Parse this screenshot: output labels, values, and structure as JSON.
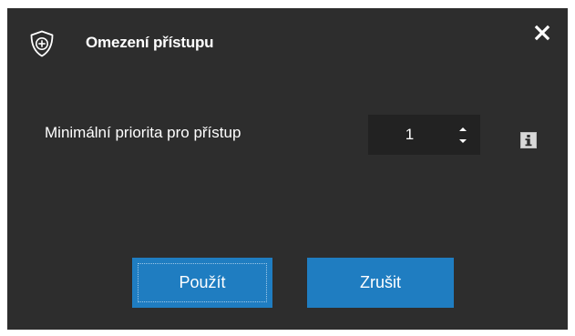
{
  "dialog": {
    "title": "Omezení přístupu",
    "icons": {
      "title_icon": "shield-plus-icon",
      "close": "close-icon",
      "info": "info-icon",
      "stepper_up": "chevron-up-icon",
      "stepper_down": "chevron-down-icon"
    },
    "field": {
      "label": "Minimální priorita pro přístup",
      "value": "1"
    },
    "buttons": {
      "apply_label": "Použít",
      "cancel_label": "Zrušit"
    },
    "colors": {
      "background": "#2d2d2d",
      "input_background": "#222222",
      "accent": "#1f7dc1",
      "text": "#ffffff"
    }
  }
}
